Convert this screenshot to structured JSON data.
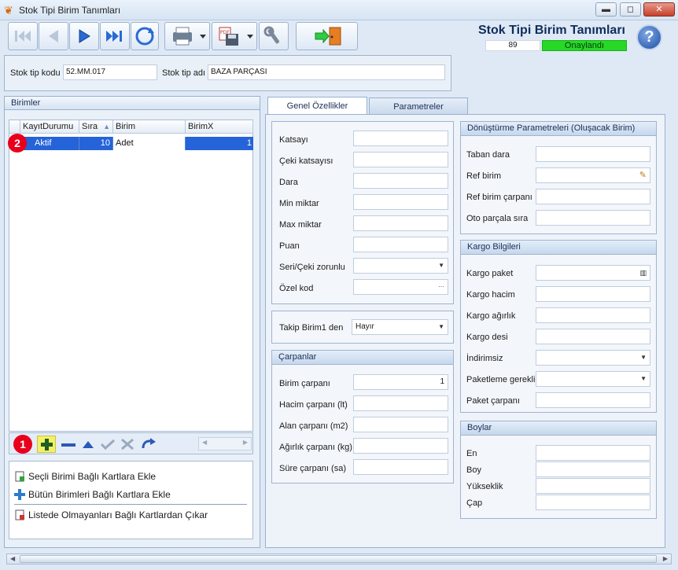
{
  "window": {
    "title": "Stok Tipi Birim Tanımları",
    "minimize": "▬",
    "maximize": "◻",
    "close": "✕"
  },
  "header": {
    "title": "Stok Tipi Birim Tanımları",
    "code": "89",
    "status": "Onaylandı",
    "help": "?"
  },
  "codebar": {
    "code_label": "Stok tip kodu",
    "code_value": "52.MM.017",
    "name_label": "Stok tip adı",
    "name_value": "BAZA PARÇASI"
  },
  "units_panel": {
    "title": "Birimler",
    "columns": [
      "KayıtDurumu",
      "Sıra",
      "Birim",
      "BirimX"
    ],
    "rows": [
      {
        "status": "Aktif",
        "order": "10",
        "unit": "Adet",
        "unitx": "1"
      }
    ],
    "badge_row": "2",
    "badge_nav": "1"
  },
  "actions": [
    "Seçli Birimi Bağlı Kartlara Ekle",
    "Bütün Birimleri Bağlı Kartlara Ekle",
    "Listede Olmayanları Bağlı Kartlardan Çıkar"
  ],
  "tabs": [
    "Genel Özellikler",
    "Parametreler"
  ],
  "general": {
    "fields": [
      "Katsayı",
      "Çeki katsayısı",
      "Dara",
      "Min miktar",
      "Max miktar",
      "Puan",
      "Seri/Çeki zorunlu",
      "Özel kod"
    ],
    "tracking_label": "Takip Birim1 den",
    "tracking_value": "Hayır"
  },
  "multipliers": {
    "title": "Çarpanlar",
    "fields": [
      "Birim çarpanı",
      "Hacim çarpanı (lt)",
      "Alan çarpanı (m2)",
      "Ağırlık çarpanı (kg)",
      "Süre çarpanı (sa)"
    ],
    "unit_multiplier_value": "1"
  },
  "conversion": {
    "title": "Dönüştürme Parametreleri (Oluşacak Birim)",
    "fields": [
      "Taban dara",
      "Ref birim",
      "Ref birim çarpanı",
      "Oto parçala sıra"
    ]
  },
  "cargo": {
    "title": "Kargo Bilgileri",
    "fields": [
      "Kargo paket",
      "Kargo hacim",
      "Kargo ağırlık",
      "Kargo desi",
      "İndirimsiz",
      "Paketleme gerekli",
      "Paket çarpanı"
    ]
  },
  "sizes": {
    "title": "Boylar",
    "fields": [
      "En",
      "Boy",
      "Yükseklik",
      "Çap"
    ]
  },
  "colors": {
    "accent": "#2563d8",
    "status_green": "#27d827",
    "badge_red": "#e8001c"
  }
}
